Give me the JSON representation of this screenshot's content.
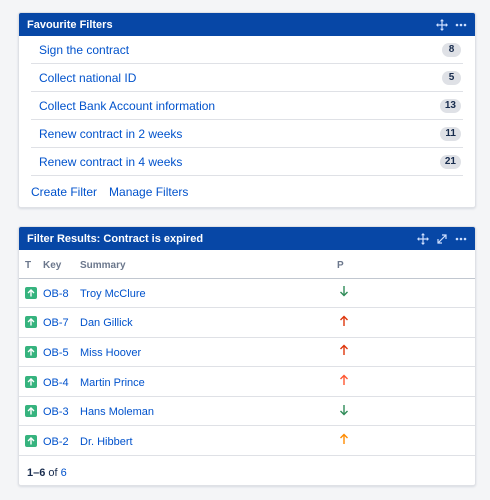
{
  "favourites": {
    "title": "Favourite Filters",
    "filters": [
      {
        "name": "Sign the contract",
        "count": "8"
      },
      {
        "name": "Collect national ID",
        "count": "5"
      },
      {
        "name": "Collect Bank Account information",
        "count": "13"
      },
      {
        "name": "Renew contract in 2 weeks",
        "count": "11"
      },
      {
        "name": "Renew contract in 4 weeks",
        "count": "21"
      }
    ],
    "create_label": "Create Filter",
    "manage_label": "Manage Filters"
  },
  "results": {
    "title": "Filter Results: Contract is expired",
    "columns": {
      "type": "T",
      "key": "Key",
      "summary": "Summary",
      "priority": "P"
    },
    "rows": [
      {
        "type_icon": "story-icon",
        "key": "OB-8",
        "summary": "Troy McClure",
        "priority": "low-priority-icon",
        "priority_color": "#36b37e"
      },
      {
        "type_icon": "story-icon",
        "key": "OB-7",
        "summary": "Dan Gillick",
        "priority": "highest-priority-icon",
        "priority_color": "#de350b"
      },
      {
        "type_icon": "story-icon",
        "key": "OB-5",
        "summary": "Miss Hoover",
        "priority": "highest-priority-icon",
        "priority_color": "#de350b"
      },
      {
        "type_icon": "story-icon",
        "key": "OB-4",
        "summary": "Martin Prince",
        "priority": "high-priority-icon",
        "priority_color": "#ff5630"
      },
      {
        "type_icon": "story-icon",
        "key": "OB-3",
        "summary": "Hans Moleman",
        "priority": "low-priority-icon",
        "priority_color": "#36b37e"
      },
      {
        "type_icon": "story-icon",
        "key": "OB-2",
        "summary": "Dr. Hibbert",
        "priority": "medium-priority-icon",
        "priority_color": "#ff8b00"
      }
    ],
    "pagination": {
      "range": "1–6",
      "of": "of",
      "total": "6"
    }
  },
  "colors": {
    "header": "#0747a6",
    "link": "#0052cc",
    "story": "#36b37e"
  }
}
